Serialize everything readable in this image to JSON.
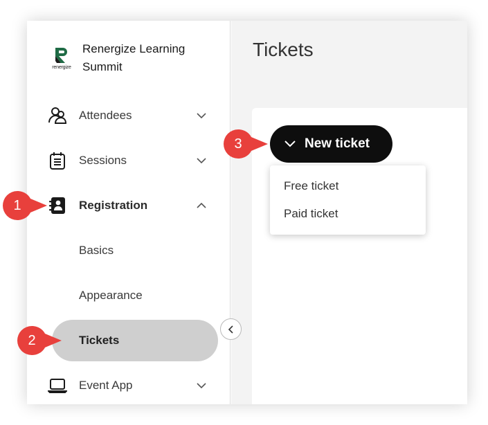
{
  "app": {
    "name": "Renergize Learning Summit",
    "logo_text": "renergize"
  },
  "sidebar": {
    "items": [
      {
        "label": "Attendees",
        "icon": "users-icon",
        "state": "collapsed"
      },
      {
        "label": "Sessions",
        "icon": "calendar-icon",
        "state": "collapsed"
      },
      {
        "label": "Registration",
        "icon": "contact-book-icon",
        "state": "expanded",
        "children": [
          "Basics",
          "Appearance",
          "Tickets"
        ],
        "selected_child": "Tickets"
      },
      {
        "label": "Event App",
        "icon": "laptop-icon",
        "state": "collapsed"
      }
    ]
  },
  "main": {
    "title": "Tickets",
    "new_ticket_button": "New ticket",
    "dropdown_options": [
      "Free ticket",
      "Paid ticket"
    ]
  },
  "callouts": [
    "1",
    "2",
    "3"
  ],
  "colors": {
    "callout": "#e8403c",
    "button": "#0e0e0e",
    "selected": "#cfcfcf",
    "logo_green": "#1f6b45"
  }
}
